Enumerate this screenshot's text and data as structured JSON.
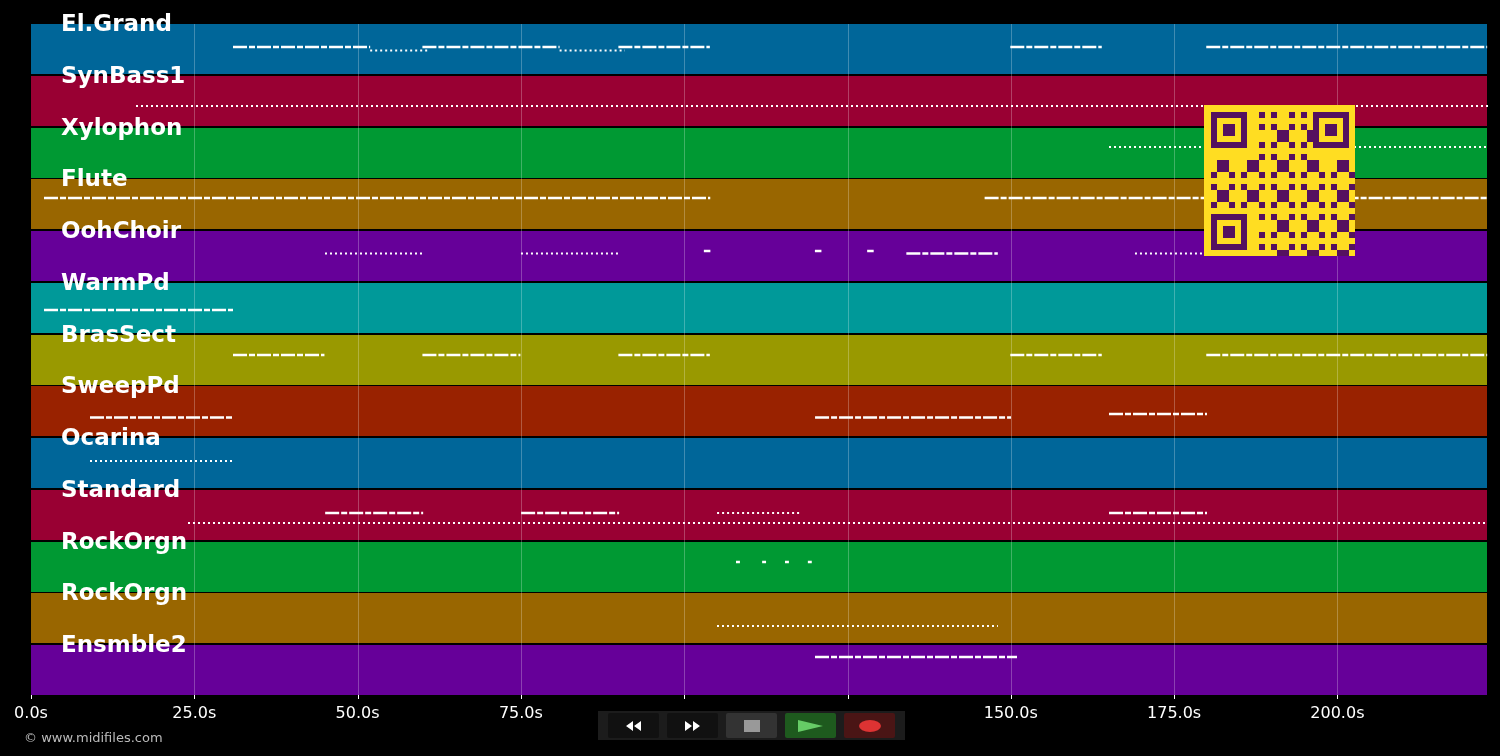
{
  "tracks": [
    {
      "name": "El.Grand",
      "color": "#006699"
    },
    {
      "name": "SynBass1",
      "color": "#990033"
    },
    {
      "name": "Xylophon",
      "color": "#009933"
    },
    {
      "name": "Flute",
      "color": "#996600"
    },
    {
      "name": "OohChoir",
      "color": "#660099"
    },
    {
      "name": "WarmPd",
      "color": "#009999"
    },
    {
      "name": "BrasSect",
      "color": "#999900"
    },
    {
      "name": "SweepPd",
      "color": "#992200"
    },
    {
      "name": "Ocarina",
      "color": "#006699"
    },
    {
      "name": "Standard",
      "color": "#990033"
    },
    {
      "name": "RockOrgn",
      "color": "#009933"
    },
    {
      "name": "RockOrgn",
      "color": "#996600"
    },
    {
      "name": "Ensmble2",
      "color": "#660099"
    }
  ],
  "time_axis": {
    "ticks_left": [
      "0.0s",
      "25.0s",
      "50.0s",
      "75.0s"
    ],
    "ticks_right": [
      "150.0s",
      "175.0s",
      "200.0s"
    ]
  },
  "transport": [
    {
      "kind": "rewind"
    },
    {
      "kind": "forward"
    },
    {
      "kind": "stop"
    },
    {
      "kind": "play"
    },
    {
      "kind": "record"
    }
  ],
  "copyright": "© www.midifiles.com"
}
